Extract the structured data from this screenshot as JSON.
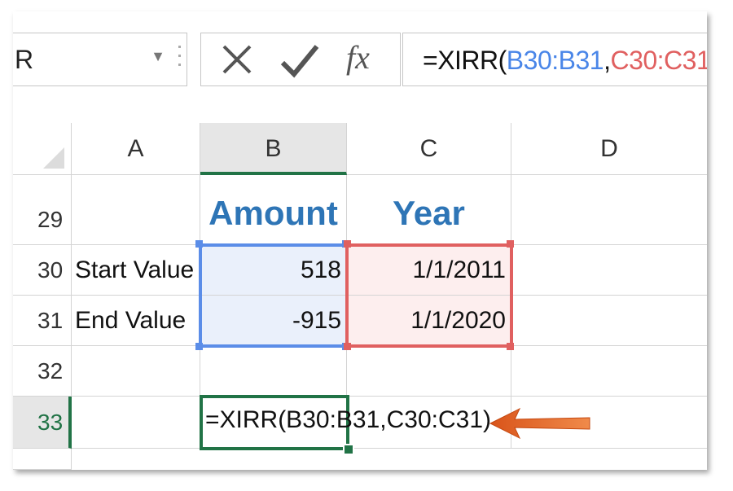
{
  "name_box": {
    "value": "R",
    "dropdown": "▼"
  },
  "formula_bar": {
    "cancel_icon": "x-icon",
    "enter_icon": "check-icon",
    "fx_label": "fx",
    "formula_prefix": "=XIRR(",
    "ref_b": "B30:B31",
    "comma": ",",
    "ref_c": "C30:C31",
    "formula_suffix": ")"
  },
  "columns": [
    "A",
    "B",
    "C",
    "D"
  ],
  "rows": [
    {
      "num": "29",
      "a": "",
      "b": "Amount",
      "c": "Year",
      "d": ""
    },
    {
      "num": "30",
      "a": "Start Value",
      "b": "518",
      "c": "1/1/2011",
      "d": ""
    },
    {
      "num": "31",
      "a": "End Value",
      "b": "-915",
      "c": "1/1/2020",
      "d": ""
    },
    {
      "num": "32",
      "a": "",
      "b": "",
      "c": "",
      "d": ""
    },
    {
      "num": "33",
      "a": "",
      "b": "=XIRR(B30:B31,C30:C31)",
      "c": "",
      "d": ""
    }
  ],
  "colors": {
    "accent_green": "#217346",
    "ref_blue": "#5b8de8",
    "ref_red": "#e06060",
    "header_blue": "#2e75b6",
    "arrow": "#e86a1f"
  }
}
